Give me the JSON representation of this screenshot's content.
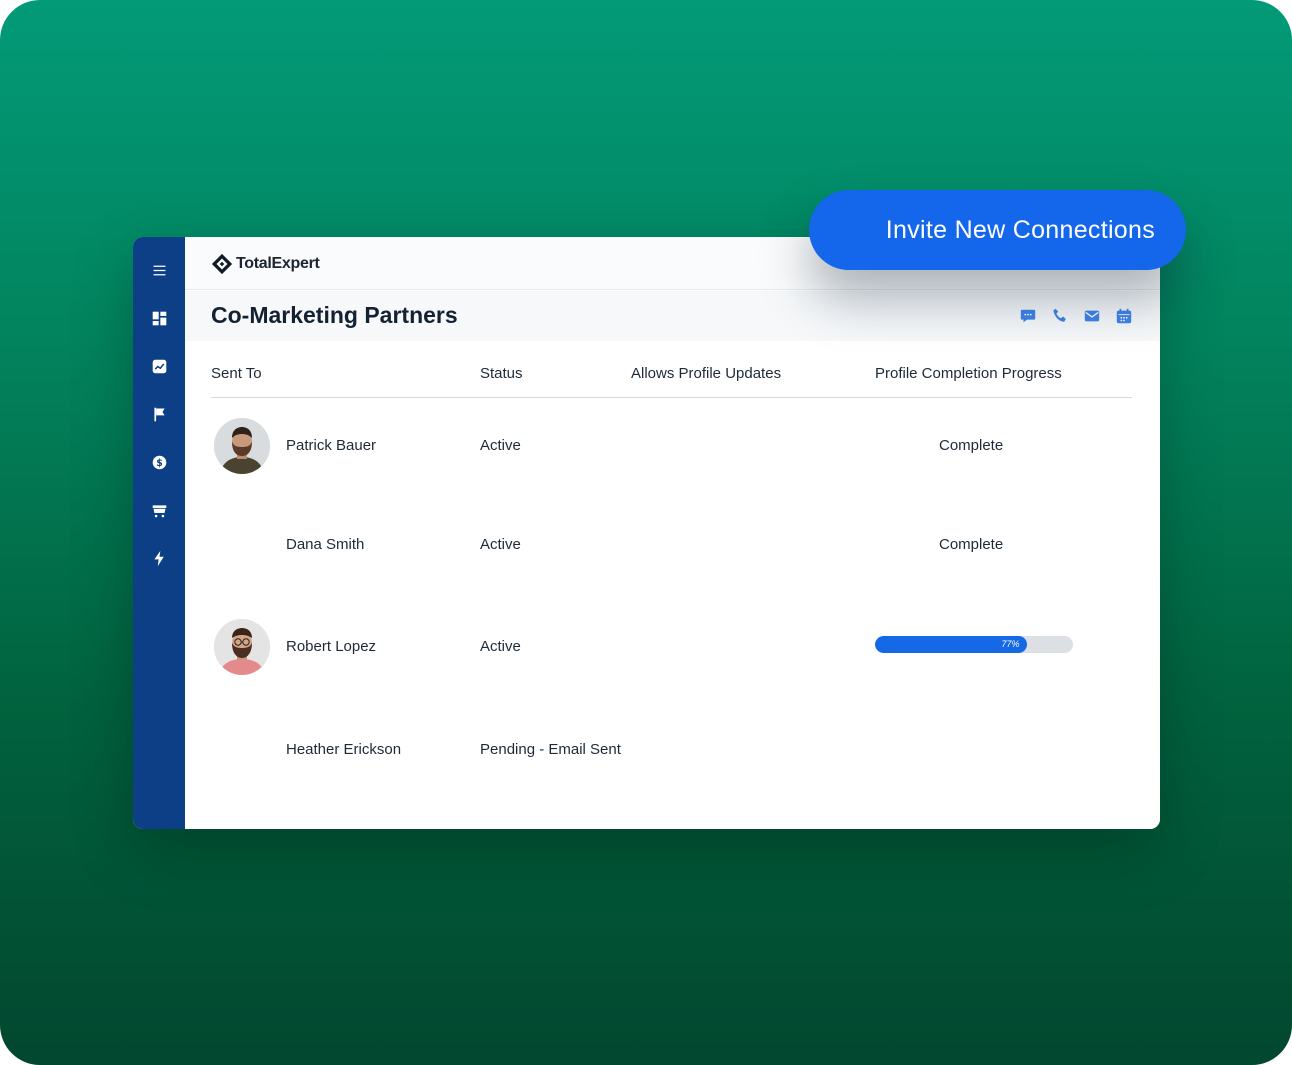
{
  "brand": {
    "name": "TotalExpert"
  },
  "page": {
    "title": "Co-Marketing Partners"
  },
  "invite_button": {
    "label": "Invite New Connections"
  },
  "sidebar": {
    "items": [
      {
        "name": "menu",
        "icon": "hamburger-menu-icon"
      },
      {
        "name": "dashboard",
        "icon": "dashboard-icon"
      },
      {
        "name": "analytics",
        "icon": "trending-chart-icon"
      },
      {
        "name": "campaigns",
        "icon": "flag-icon"
      },
      {
        "name": "finance",
        "icon": "dollar-icon"
      },
      {
        "name": "marketplace",
        "icon": "shopping-cart-icon"
      },
      {
        "name": "automation",
        "icon": "lightning-icon"
      }
    ]
  },
  "header_actions": [
    {
      "icon": "chat-icon"
    },
    {
      "icon": "phone-icon"
    },
    {
      "icon": "mail-icon"
    },
    {
      "icon": "calendar-icon"
    }
  ],
  "table": {
    "columns": {
      "sent_to": "Sent To",
      "status": "Status",
      "allows_updates": "Allows Profile Updates",
      "progress": "Profile Completion Progress"
    },
    "rows": [
      {
        "name": "Patrick Bauer",
        "status": "Active",
        "allows_updates": "",
        "progress_text": "Complete",
        "has_avatar": true
      },
      {
        "name": "Dana Smith",
        "status": "Active",
        "allows_updates": "",
        "progress_text": "Complete",
        "has_avatar": false
      },
      {
        "name": "Robert Lopez",
        "status": "Active",
        "allows_updates": "",
        "progress_percent": 77,
        "progress_label": "77%",
        "has_avatar": true
      },
      {
        "name": "Heather Erickson",
        "status": "Pending - Email Sent",
        "allows_updates": "",
        "progress_text": "",
        "has_avatar": false
      }
    ]
  },
  "colors": {
    "background_top": "#039a78",
    "background_bottom": "#02472f",
    "sidebar": "#0c3f86",
    "accent": "#1466ea",
    "progress_track": "#dcdfe4"
  }
}
